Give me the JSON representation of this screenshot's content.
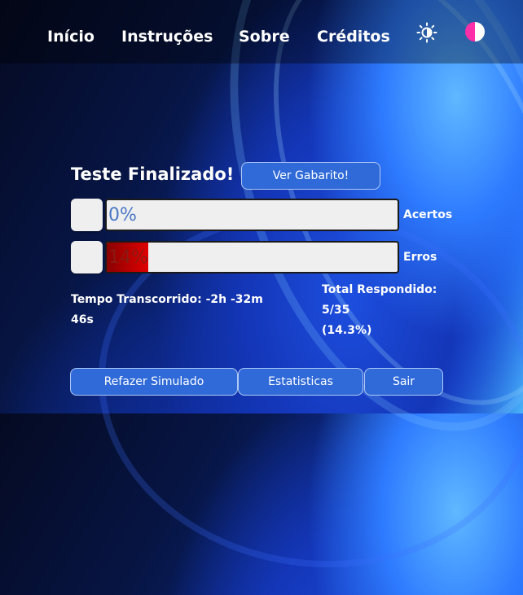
{
  "nav": {
    "links": [
      "Início",
      "Instruções",
      "Sobre",
      "Créditos"
    ]
  },
  "icons": {
    "theme_toggle": "sun-icon",
    "contrast_toggle": "contrast-icon",
    "contrast_colors": [
      "#ff2fa8",
      "#ffffff"
    ]
  },
  "result": {
    "title": "Teste Finalizado!",
    "answer_key_button": "Ver Gabarito!"
  },
  "progress": {
    "correct": {
      "text": "0%",
      "fraction": 0.0,
      "label": "Acertos",
      "color": "#4a78c4"
    },
    "errors": {
      "text": "14%",
      "fraction": 0.143,
      "label": "Erros",
      "color": "#8b1a14"
    }
  },
  "stats": {
    "elapsed_label": "Tempo Transcorrido: -2h -32m",
    "elapsed_tail": "46s",
    "answered_label": "Total Respondido:",
    "answered_count": "5/35",
    "answered_percent": "(14.3%)"
  },
  "actions": {
    "retry": "Refazer Simulado",
    "stats": "Estatisticas",
    "exit": "Sair"
  },
  "colors": {
    "button_bg": "#2f6ad8",
    "error_fill_start": "#8a0000",
    "error_fill_end": "#e00000"
  }
}
